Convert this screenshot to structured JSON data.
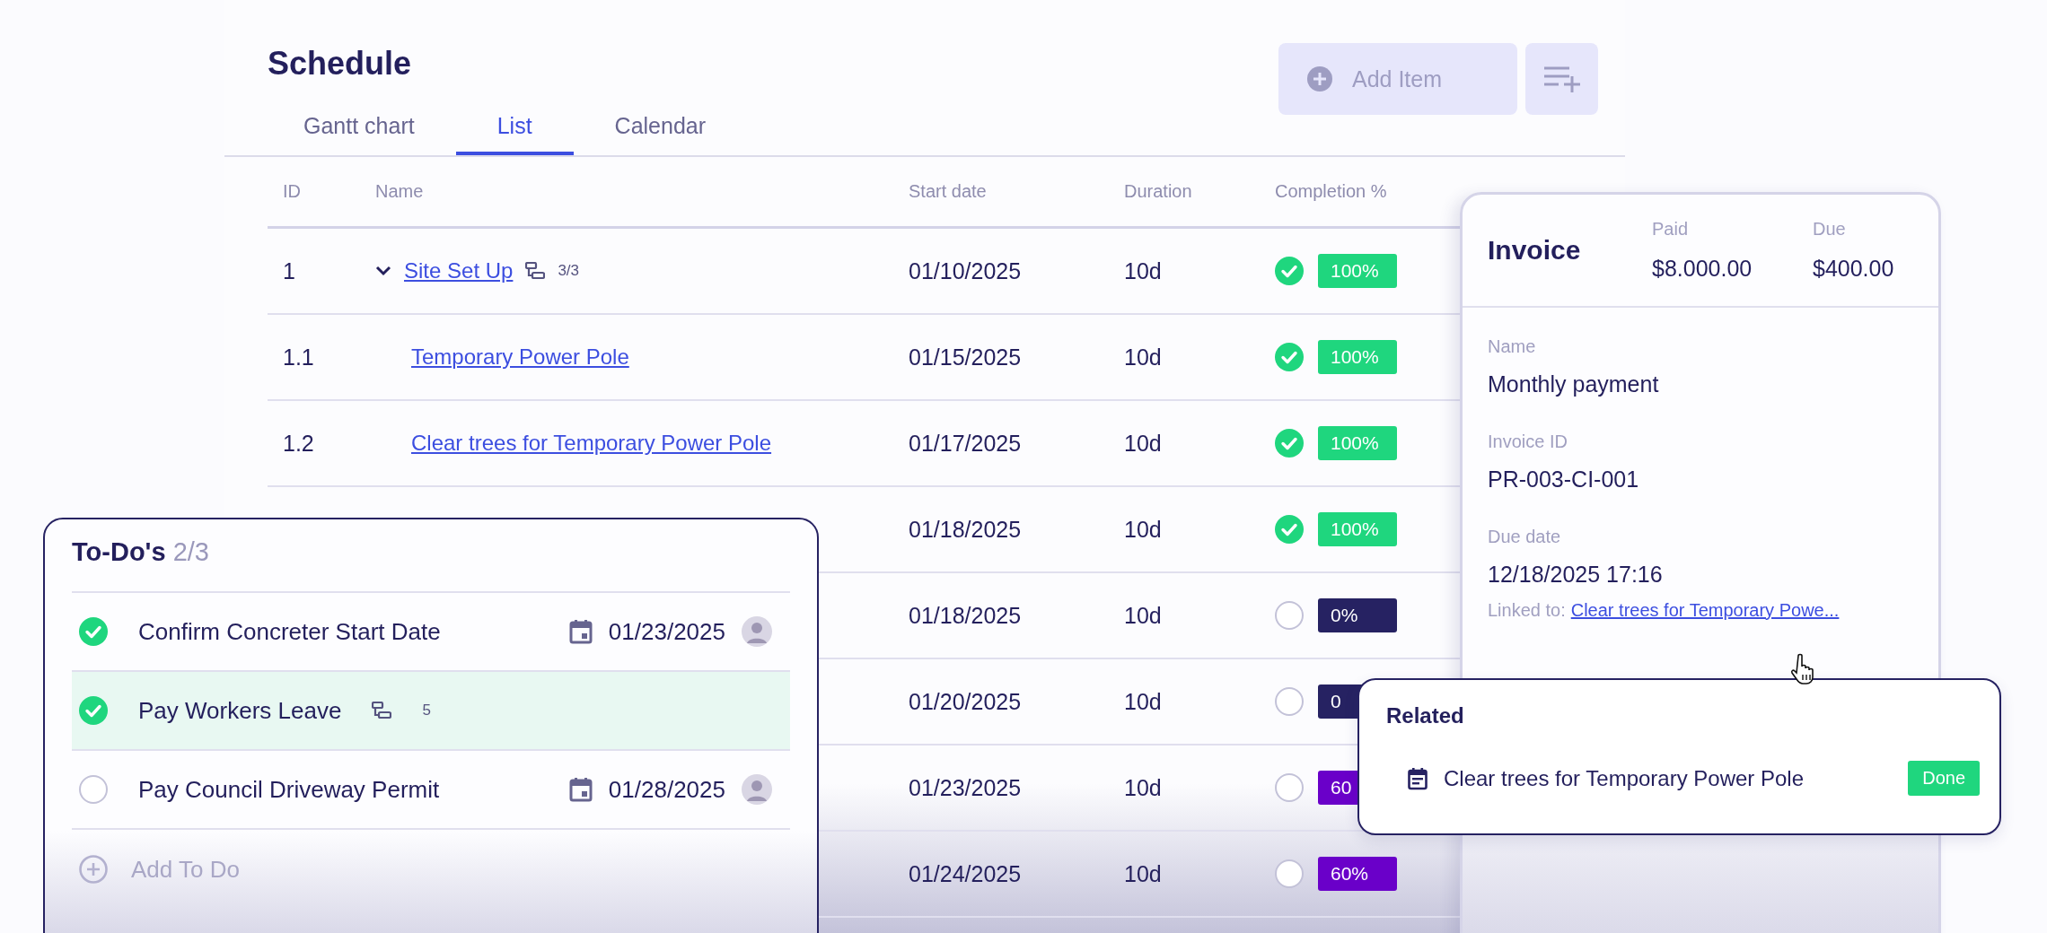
{
  "schedule": {
    "title": "Schedule",
    "tabs": [
      {
        "label": "Gantt chart",
        "selected": false
      },
      {
        "label": "List",
        "selected": true
      },
      {
        "label": "Calendar",
        "selected": false
      }
    ],
    "add_button": {
      "label": "Add Item"
    },
    "table": {
      "columns": [
        "ID",
        "Name",
        "Start date",
        "Duration",
        "Completion %"
      ],
      "rows": [
        {
          "id": "1",
          "name": "Site Set Up",
          "expanded": true,
          "subtasks": "3/3",
          "start": "01/10/2025",
          "duration": "10d",
          "complete": true,
          "badge": "100%",
          "color": "#1fd67e",
          "children": [
            {
              "id": "1.1",
              "name": "Temporary Power Pole",
              "start": "01/15/2025",
              "duration": "10d",
              "complete": true,
              "badge": "100%",
              "color": "#1fd67e"
            },
            {
              "id": "1.2",
              "name": "Clear trees for Temporary Power Pole",
              "start": "01/17/2025",
              "duration": "10d",
              "complete": true,
              "badge": "100%",
              "color": "#1fd67e"
            }
          ]
        },
        {
          "start": "01/18/2025",
          "duration": "10d",
          "complete": true,
          "badge": "100%",
          "color": "#1fd67e"
        },
        {
          "start": "01/18/2025",
          "duration": "10d",
          "complete": false,
          "badge": "0%",
          "color": "#262262"
        },
        {
          "start": "01/20/2025",
          "duration": "10d",
          "complete": false,
          "badge": "0",
          "color": "#262262"
        },
        {
          "start": "01/23/2025",
          "duration": "10d",
          "complete": false,
          "badge": "60",
          "color": "#6a00c9"
        },
        {
          "start": "01/24/2025",
          "duration": "10d",
          "complete": false,
          "badge": "60%",
          "color": "#6a00c9"
        }
      ]
    }
  },
  "todos": {
    "title": "To-Do's",
    "count": "2/3",
    "items": [
      {
        "text": "Confirm Concreter Start Date",
        "checked": true,
        "selected": false,
        "due": "01/23/2025",
        "avatar": true
      },
      {
        "text": "Pay Workers Leave",
        "checked": true,
        "selected": true,
        "subtasks": "5"
      },
      {
        "text": "Pay Council Driveway Permit",
        "checked": false,
        "selected": false,
        "due": "01/28/2025",
        "avatar": true
      }
    ],
    "add_label": "Add To Do"
  },
  "invoice": {
    "title": "Invoice",
    "totals": [
      {
        "label": "Paid",
        "value": "$8.000.00"
      },
      {
        "label": "Due",
        "value": "$400.00"
      }
    ],
    "fields": [
      {
        "label": "Name",
        "value": "Monthly payment"
      },
      {
        "label": "Invoice ID",
        "value": "PR-003-CI-001"
      },
      {
        "label": "Due date",
        "value": "12/18/2025 17:16"
      }
    ],
    "linked_label": "Linked to:",
    "linked_link": "Clear trees for Temporary Powe..."
  },
  "related": {
    "title": "Related",
    "items": [
      {
        "text": "Clear trees for Temporary Power Pole",
        "status": "Done"
      }
    ]
  }
}
